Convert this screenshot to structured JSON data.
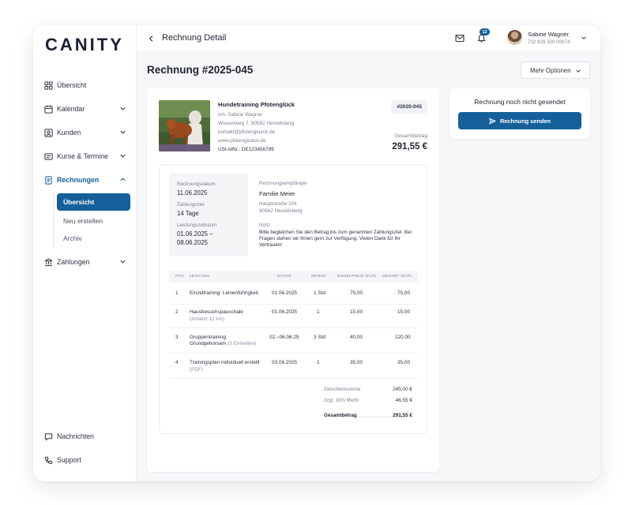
{
  "brand": {
    "logo": "CANITY",
    "accent": "#15609b"
  },
  "nav": {
    "overview": "Übersicht",
    "calendar": "Kalendar",
    "customers": "Kunden",
    "courses": "Kurse & Termine",
    "invoices": "Rechnungen",
    "invoices_sub": [
      "Übersicht",
      "Neu erstellen",
      "Archiv"
    ],
    "payments": "Zahlungen",
    "messages": "Nachrichten",
    "support": "Support"
  },
  "topbar": {
    "title": "Rechnung Detail",
    "notifications_count": "12",
    "user_name": "Sabine Wagner",
    "user_phone": "732 829 320 00074"
  },
  "invoice": {
    "heading": "Rechnung #2025-045",
    "more_options": "Mehr Optionen",
    "number_badge": "#2020-045",
    "company": {
      "name": "Hundetraining Pfotenglück",
      "owner": "Inh. Sabine Wagner",
      "address": "Wiesenweg 7, 90562 Heroldsberg",
      "email": "kontakt@pfotenglueck.de",
      "website": "www.pfotenglueck.de",
      "vat_id": "USt-IdNr.: DE123456789"
    },
    "total_label": "Gesamtbetrag",
    "total_value": "291,55 €",
    "meta": {
      "date_label": "Rechnungsdatum",
      "date": "11.06.2025",
      "due_label": "Zahlungsziel",
      "due": "14 Tage",
      "period_label": "Leistungszeitraum",
      "period_line1": "01.06.2025 –",
      "period_line2": "08.06.2025"
    },
    "recipient": {
      "label": "Rechnungsempfänger",
      "name": "Familie Meier",
      "street": "Hauptstraße 104",
      "city": "90562 Heroldsberg"
    },
    "note": {
      "label": "Notiz",
      "text": "Bitte begleichen Sie den Betrag bis zum genannten Zahlungsziel. Bei Fragen stehen wir Ihnen gern zur Verfügung. Vielen Dank für Ihr Vertrauen!"
    },
    "table": {
      "headers": [
        "POS",
        "LEISTUNG",
        "DATUM",
        "MENGE",
        "EINZELPREIS (EUR)",
        "GESAMT (EUR)"
      ],
      "rows": [
        {
          "pos": "1",
          "service": "Einzeltraining: Leinenführigkeit",
          "detail": "",
          "date": "01.06.2025",
          "qty": "1 Std",
          "unit": "75,00",
          "total": "75,00"
        },
        {
          "pos": "2",
          "service": "Hausbesuchspauschale",
          "detail": "(Anfahrt 12 km)",
          "date": "01.06.2025",
          "qty": "1",
          "unit": "15,00",
          "total": "15,00"
        },
        {
          "pos": "3",
          "service": "Gruppentraining:",
          "service2": "Grundgehorsam",
          "detail": "(3 Einheiten)",
          "date": "02.–06.06.25",
          "qty": "3 Std",
          "unit": "40,00",
          "total": "120,00"
        },
        {
          "pos": "4",
          "service": "Trainingsplan individuell erstellt",
          "detail": "(PDF)",
          "date": "03.06.2025",
          "qty": "1",
          "unit": "35,00",
          "total": "35,00"
        }
      ]
    },
    "summary": {
      "subtotal_label": "Zwischensumme",
      "subtotal": "245,00 €",
      "vat_label": "zzgl. 19% MwSt",
      "vat": "46,55 €",
      "total_label": "Gesamtbetrag",
      "total": "291,55 €"
    }
  },
  "send_panel": {
    "status": "Rechnung noch nicht gesendet",
    "button": "Rechnung senden"
  }
}
